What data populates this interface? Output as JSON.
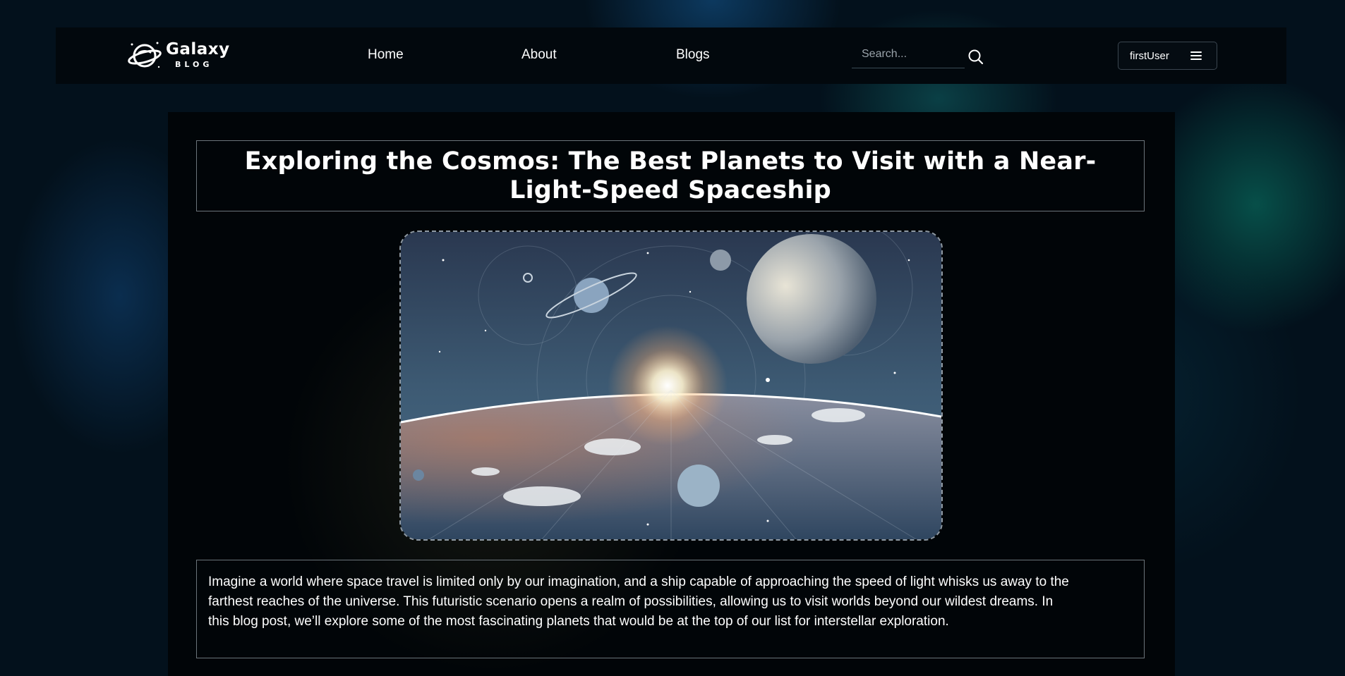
{
  "nav": {
    "logo": {
      "title": "Galaxy",
      "subtitle": "BLOG",
      "icon": "planet-logo-icon"
    },
    "links": [
      {
        "label": "Home"
      },
      {
        "label": "About"
      },
      {
        "label": "Blogs"
      }
    ],
    "search": {
      "placeholder": "Search...",
      "value": "",
      "icon": "search-icon"
    },
    "user": {
      "name": "firstUser",
      "menu_icon": "hamburger-menu-icon"
    }
  },
  "post": {
    "title": "Exploring the Cosmos: The Best Planets to Visit with a Near-Light-Speed Spaceship",
    "image": {
      "icon": "space-planets-illustration"
    },
    "intro": "Imagine a world where space travel is limited only by our imagination, and a ship capable of approaching the speed of light whisks us away to the farthest reaches of the universe. This futuristic scenario opens a realm of possibilities, allowing us to visit worlds beyond our wildest dreams. In this blog post, we’ll explore some of the most fascinating planets that would be at the top of our list for interstellar exploration."
  },
  "colors": {
    "page_bg": "#03111c",
    "navbar_bg": "#02080d",
    "card_bg": "#010508",
    "border": "#6b747a",
    "text": "#ffffff"
  }
}
